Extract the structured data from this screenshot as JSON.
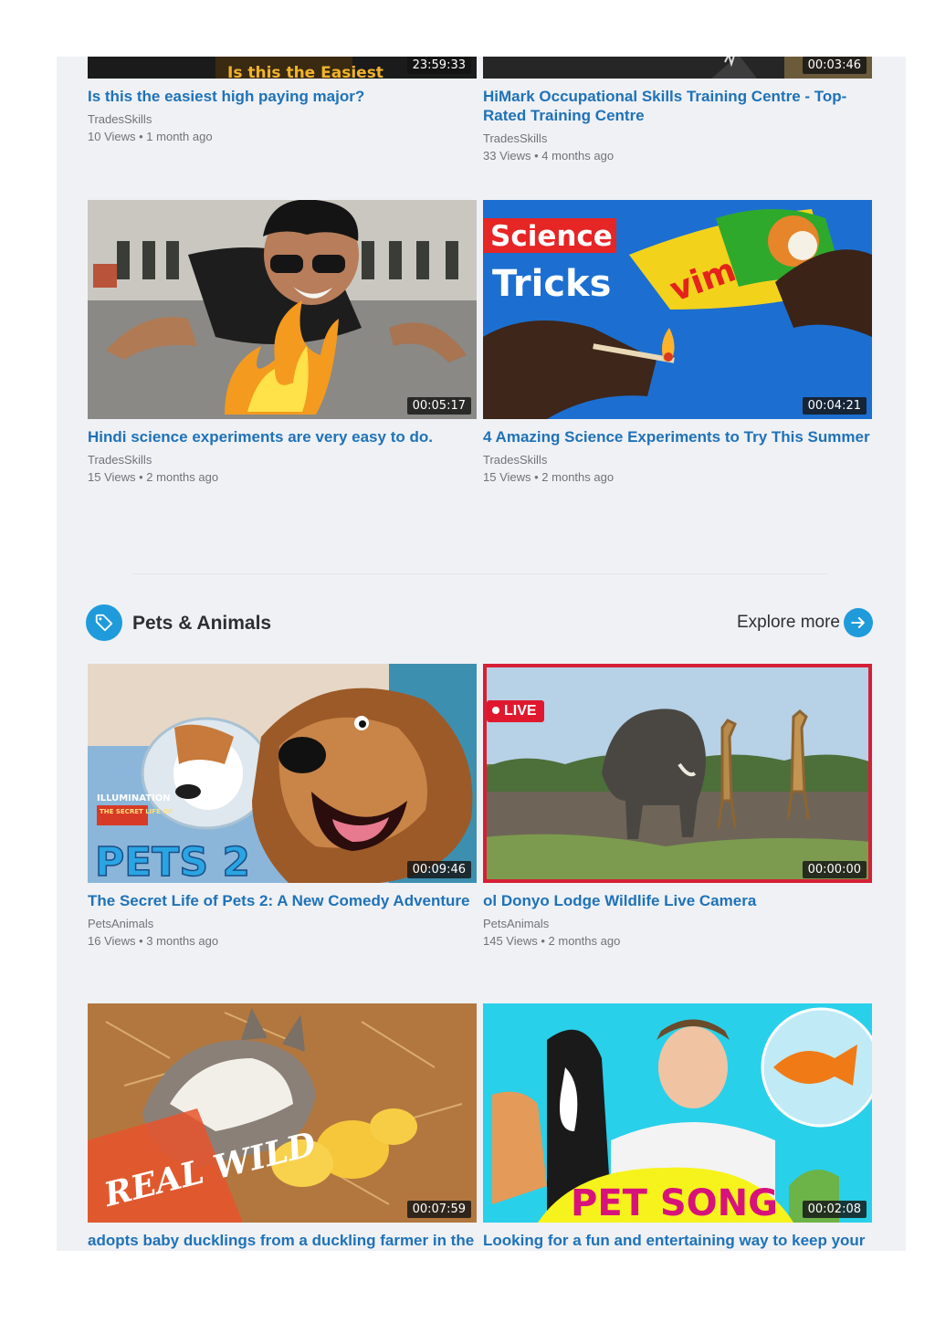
{
  "videos_top": [
    {
      "title": "Is this the easiest high paying major?",
      "channel": "TradesSkills",
      "meta": "10 Views • 1 month ago",
      "duration": "23:59:33",
      "thumb_text": "Is this the Easiest"
    },
    {
      "title": "HiMark Occupational Skills Training Centre - Top-Rated Training Centre",
      "channel": "TradesSkills",
      "meta": "33 Views • 4 months ago",
      "duration": "00:03:46"
    },
    {
      "title": "Hindi science experiments are very easy to do.",
      "channel": "TradesSkills",
      "meta": "15 Views • 2 months ago",
      "duration": "00:05:17"
    },
    {
      "title": "4 Amazing Science Experiments to Try This Summer",
      "channel": "TradesSkills",
      "meta": "15 Views • 2 months ago",
      "duration": "00:04:21",
      "thumb_text_1": "Science",
      "thumb_text_2": "Tricks"
    }
  ],
  "section": {
    "title": "Pets & Animals",
    "explore_label": "Explore more",
    "icon": "tag-icon",
    "accent": "#1f9bdb"
  },
  "videos_pets": [
    {
      "title": "The Secret Life of Pets 2: A New Comedy Adventure",
      "channel": "PetsAnimals",
      "meta": "16 Views • 3 months ago",
      "duration": "00:09:46",
      "thumb_text_1": "ILLUMINATION",
      "thumb_text_2": "THE SECRET LIFE OF",
      "thumb_text_3": "PETS 2"
    },
    {
      "title": "ol Donyo Lodge Wildlife Live Camera",
      "channel": "PetsAnimals",
      "meta": "145 Views • 2 months ago",
      "duration": "00:00:00",
      "live_label": "LIVE"
    },
    {
      "title": "adopts baby ducklings from a duckling farmer in the",
      "duration": "00:07:59",
      "thumb_text": "REAL WILD"
    },
    {
      "title": "Looking for a fun and entertaining way to keep your",
      "duration": "00:02:08",
      "thumb_text": "PET SONG"
    }
  ],
  "colors": {
    "title_link": "#1f72b8",
    "live": "#e0182e",
    "background": "#eff1f5"
  }
}
